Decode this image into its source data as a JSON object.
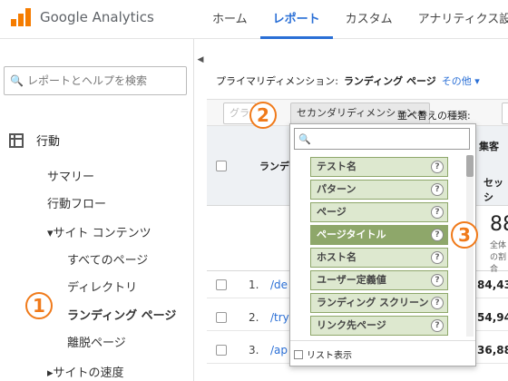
{
  "app": {
    "logo_text": "Google Analytics",
    "brand_color": "#f57c00"
  },
  "nav": {
    "items": [
      {
        "label": "ホーム"
      },
      {
        "label": "レポート"
      },
      {
        "label": "カスタム"
      },
      {
        "label": "アナリティクス設定"
      }
    ],
    "active": "レポート"
  },
  "sidebar": {
    "search_placeholder": "レポートとヘルプを検索",
    "section_label": "行動",
    "items": {
      "summary": "サマリー",
      "flow": "行動フロー",
      "site_content": "▾サイト コンテンツ",
      "all_pages": "すべてのページ",
      "directory": "ディレクトリ",
      "landing": "ランディング ページ",
      "exit": "離脱ページ",
      "speed": "▸サイトの速度"
    }
  },
  "badges": {
    "one": "1",
    "two": "2",
    "three": "3"
  },
  "main": {
    "primary_dim_label": "プライマリディメンション:",
    "primary_dim_value": "ランディング ページ",
    "other_label": "その他 ▾",
    "graph_btn": "グラ",
    "secondary_btn": "セカンダリディメンション ▾",
    "sort_label": "並べ替えの種類:"
  },
  "table": {
    "col_header": "ランディ",
    "metric_header": "集客",
    "metric_sub": "セッシ",
    "summary_value": "88",
    "summary_sub": "全体の割合",
    "rows": [
      {
        "num": "1.",
        "link": "/de",
        "value": "84,43"
      },
      {
        "num": "2.",
        "link": "/try",
        "value": "54,94"
      },
      {
        "num": "3.",
        "link": "/ap",
        "value": "36,88"
      }
    ]
  },
  "popup": {
    "search_value": "",
    "options": [
      {
        "label": "テスト名",
        "selected": false
      },
      {
        "label": "パターン",
        "selected": false
      },
      {
        "label": "ページ",
        "selected": false
      },
      {
        "label": "ページタイトル",
        "selected": true
      },
      {
        "label": "ホスト名",
        "selected": false
      },
      {
        "label": "ユーザー定義値",
        "selected": false
      },
      {
        "label": "ランディング スクリーン",
        "selected": false
      },
      {
        "label": "リンク先ページ",
        "selected": false
      }
    ],
    "help_glyph": "?",
    "list_view_label": "リスト表示"
  }
}
